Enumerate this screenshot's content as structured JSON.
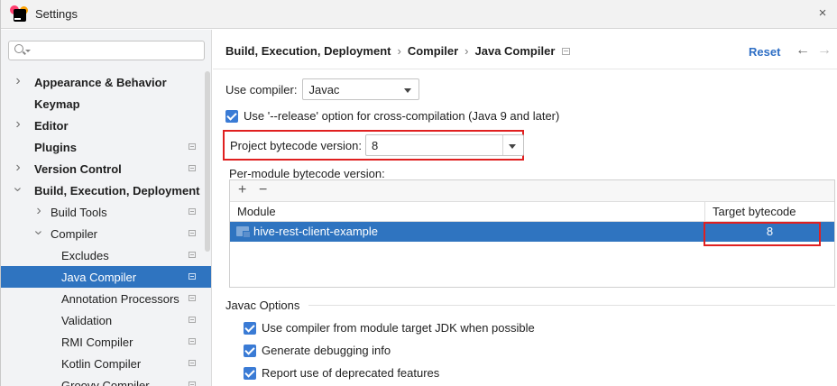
{
  "window": {
    "title": "Settings",
    "close_glyph": "×"
  },
  "sidebar": {
    "search_placeholder": "",
    "items": [
      {
        "label": "Appearance & Behavior"
      },
      {
        "label": "Keymap"
      },
      {
        "label": "Editor"
      },
      {
        "label": "Plugins"
      },
      {
        "label": "Version Control"
      },
      {
        "label": "Build, Execution, Deployment"
      },
      {
        "label": "Build Tools"
      },
      {
        "label": "Compiler"
      },
      {
        "label": "Excludes"
      },
      {
        "label": "Java Compiler"
      },
      {
        "label": "Annotation Processors"
      },
      {
        "label": "Validation"
      },
      {
        "label": "RMI Compiler"
      },
      {
        "label": "Kotlin Compiler"
      },
      {
        "label": "Groovy Compiler"
      }
    ],
    "selected": "Java Compiler"
  },
  "header": {
    "breadcrumb": [
      "Build, Execution, Deployment",
      "Compiler",
      "Java Compiler"
    ],
    "separator": "›",
    "reset_label": "Reset",
    "back_glyph": "←",
    "forward_glyph": "→"
  },
  "compiler": {
    "use_compiler_label": "Use compiler:",
    "use_compiler_value": "Javac",
    "release_option_label": "Use '--release' option for cross-compilation (Java 9 and later)",
    "release_option_checked": true,
    "bytecode_label": "Project bytecode version:",
    "bytecode_value": "8",
    "per_module_label": "Per-module bytecode version:"
  },
  "table": {
    "add_glyph": "+",
    "remove_glyph": "−",
    "columns": [
      "Module",
      "Target bytecode version"
    ],
    "rows": [
      {
        "module": "hive-rest-client-example",
        "target": "8"
      }
    ]
  },
  "javac_options": {
    "title": "Javac Options",
    "options": [
      {
        "label": "Use compiler from module target JDK when possible",
        "checked": true
      },
      {
        "label": "Generate debugging info",
        "checked": true
      },
      {
        "label": "Report use of deprecated features",
        "checked": true
      }
    ]
  },
  "colors": {
    "selection": "#2f74c0",
    "accent_link": "#2f6fc5",
    "checkbox": "#3a7bd5",
    "highlight_box": "#e02020"
  }
}
